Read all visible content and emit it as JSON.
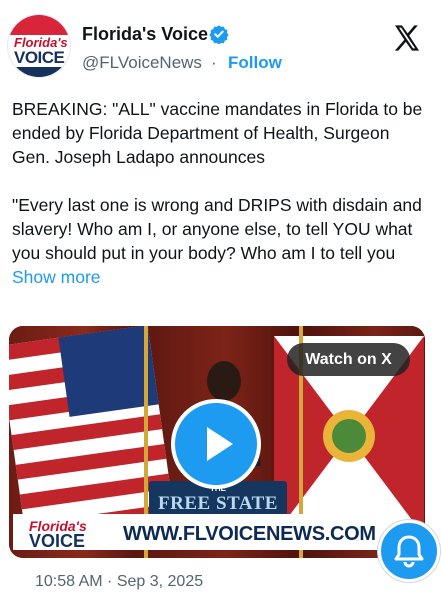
{
  "account": {
    "display_name": "Florida's Voice",
    "handle": "@FLVoiceNews",
    "separator": "·",
    "follow_label": "Follow",
    "avatar_text": {
      "line1": "Florida's",
      "line2": "VOICE"
    }
  },
  "post": {
    "paragraph1": "BREAKING: \"ALL\" vaccine mandates in Florida to be ended by Florida Department of Health, Surgeon Gen. Joseph Ladapo announces",
    "paragraph2": "\"Every last one is wrong and DRIPS with disdain and slavery! Who am I, or anyone else, to tell YOU what you should put in your body? Who am I to tell you",
    "show_more_label": "Show more"
  },
  "video": {
    "watch_label": "Watch on X",
    "podium_small": "THE",
    "podium_big": "FREE STATE",
    "banner_logo_line1": "Florida's",
    "banner_logo_line2": "VOICE",
    "banner_url": "WWW.FLVOICENEWS.COM"
  },
  "footer": {
    "timestamp": "10:58 AM · Sep 3, 2025"
  },
  "icons": {
    "verified": "verified-badge-icon",
    "x_logo": "x-logo-icon",
    "play": "play-icon",
    "bell": "notification-bell-icon"
  },
  "colors": {
    "accent": "#1d9bf0",
    "text_primary": "#0f1419",
    "text_secondary": "#536471",
    "brand_red": "#c8102e",
    "brand_navy": "#16325c"
  }
}
